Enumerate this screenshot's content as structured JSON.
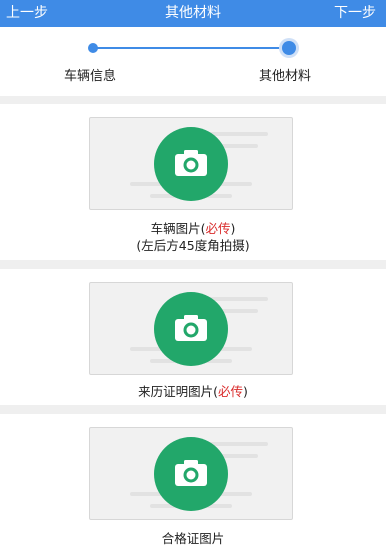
{
  "header": {
    "back_label": "上一步",
    "title": "其他材料",
    "next_label": "下一步"
  },
  "steps": {
    "step1_label": "车辆信息",
    "step2_label": "其他材料"
  },
  "uploads": [
    {
      "caption": "车辆图片",
      "required_open": "(",
      "required_text": "必传",
      "required_close": ")",
      "hint": "(左后方45度角拍摄)"
    },
    {
      "caption": "来历证明图片",
      "required_open": "(",
      "required_text": "必传",
      "required_close": ")"
    },
    {
      "caption": "合格证图片"
    }
  ],
  "colors": {
    "accent": "#3f8be6",
    "camera": "#22a76a",
    "required": "#d92b2b"
  },
  "icons": {
    "upload": "camera-icon"
  }
}
